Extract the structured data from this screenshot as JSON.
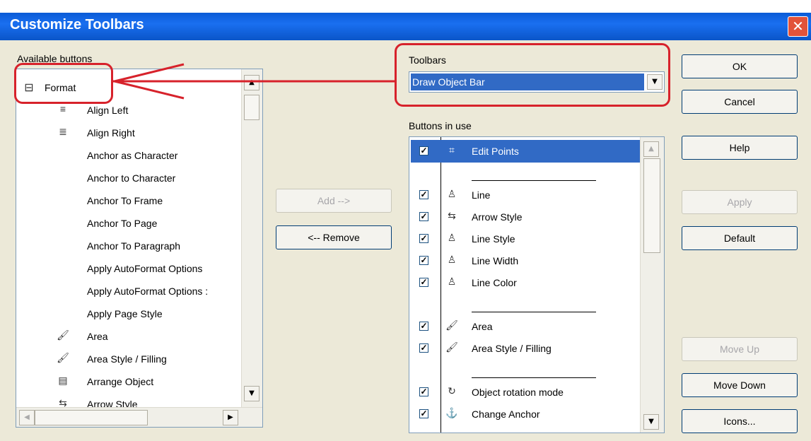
{
  "window": {
    "title": "Customize Toolbars",
    "close_glyph": "✕"
  },
  "available": {
    "label": "Available buttons",
    "group": {
      "toggle": "⊟",
      "name": "Format"
    },
    "items": [
      {
        "icon": "≡",
        "icon_name": "align-left-icon",
        "label": "Align Left"
      },
      {
        "icon": "≣",
        "icon_name": "align-right-icon",
        "label": "Align Right"
      },
      {
        "icon": "",
        "icon_name": "",
        "label": "Anchor as Character"
      },
      {
        "icon": "",
        "icon_name": "",
        "label": "Anchor to Character"
      },
      {
        "icon": "",
        "icon_name": "",
        "label": "Anchor To Frame"
      },
      {
        "icon": "",
        "icon_name": "",
        "label": "Anchor To Page"
      },
      {
        "icon": "",
        "icon_name": "",
        "label": "Anchor To Paragraph"
      },
      {
        "icon": "",
        "icon_name": "",
        "label": "Apply AutoFormat Options"
      },
      {
        "icon": "",
        "icon_name": "",
        "label": "Apply AutoFormat Options :"
      },
      {
        "icon": "",
        "icon_name": "",
        "label": "Apply Page Style"
      },
      {
        "icon": "🖌",
        "icon_name": "area-icon",
        "label": "Area"
      },
      {
        "icon": "🖌",
        "icon_name": "area-filling-icon",
        "label": "Area Style / Filling"
      },
      {
        "icon": "▤",
        "icon_name": "arrange-object-icon",
        "label": "Arrange Object"
      },
      {
        "icon": "⇆",
        "icon_name": "arrow-style-icon",
        "label": "Arrow Style"
      }
    ]
  },
  "middle": {
    "add_label": "Add -->",
    "remove_label": "<-- Remove"
  },
  "toolbars": {
    "label": "Toolbars",
    "selected": "Draw Object Bar"
  },
  "in_use": {
    "label": "Buttons in use",
    "items": [
      {
        "type": "item",
        "checked": true,
        "icon": "⌗",
        "icon_name": "edit-points-icon",
        "label": "Edit Points",
        "selected": true
      },
      {
        "type": "separator"
      },
      {
        "type": "item",
        "checked": true,
        "icon": "♙",
        "icon_name": "line-icon",
        "label": "Line"
      },
      {
        "type": "item",
        "checked": true,
        "icon": "⇆",
        "icon_name": "arrow-style-icon",
        "label": "Arrow Style"
      },
      {
        "type": "item",
        "checked": true,
        "icon": "♙",
        "icon_name": "line-style-icon",
        "label": "Line Style"
      },
      {
        "type": "item",
        "checked": true,
        "icon": "♙",
        "icon_name": "line-width-icon",
        "label": "Line Width"
      },
      {
        "type": "item",
        "checked": true,
        "icon": "♙",
        "icon_name": "line-color-icon",
        "label": "Line Color"
      },
      {
        "type": "separator"
      },
      {
        "type": "item",
        "checked": true,
        "icon": "🖌",
        "icon_name": "area-icon",
        "label": "Area"
      },
      {
        "type": "item",
        "checked": true,
        "icon": "🖌",
        "icon_name": "area-filling-icon",
        "label": "Area Style / Filling"
      },
      {
        "type": "separator"
      },
      {
        "type": "item",
        "checked": true,
        "icon": "↻",
        "icon_name": "rotation-icon",
        "label": "Object rotation mode"
      },
      {
        "type": "item",
        "checked": true,
        "icon": "⚓",
        "icon_name": "anchor-icon",
        "label": "Change Anchor"
      }
    ]
  },
  "right": {
    "ok": "OK",
    "cancel": "Cancel",
    "help": "Help",
    "apply": "Apply",
    "default": "Default",
    "move_up": "Move Up",
    "move_down": "Move Down",
    "icons": "Icons..."
  },
  "annotation_color": "#d7222b"
}
